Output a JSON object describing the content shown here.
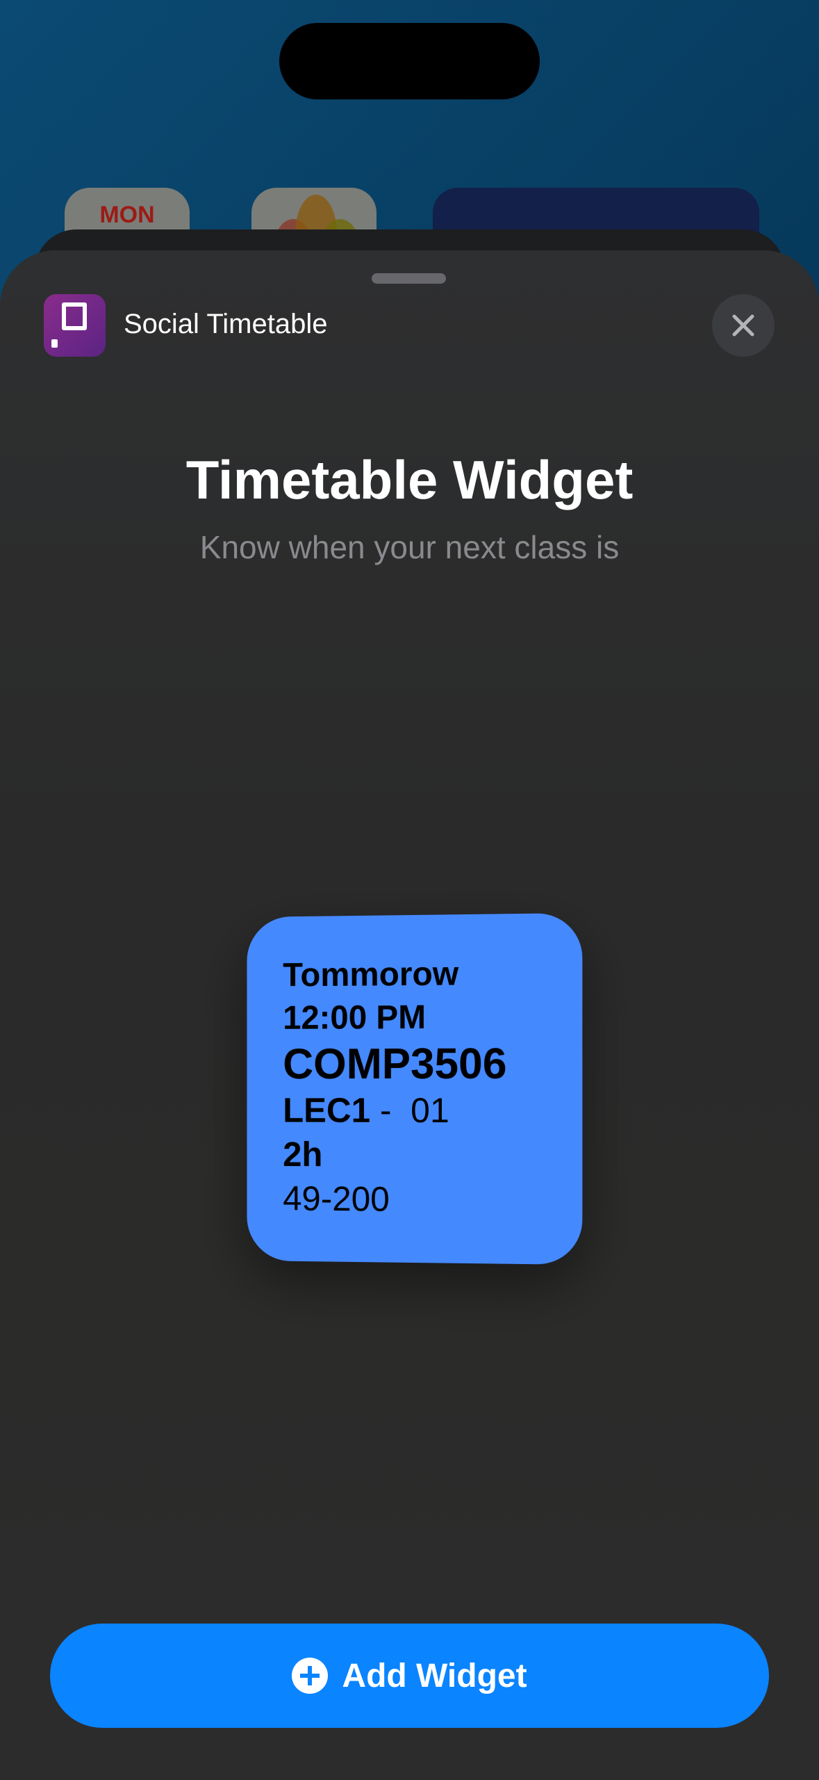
{
  "background_icons": {
    "calendar_day": "MON"
  },
  "header": {
    "app_name": "Social Timetable",
    "close_icon": "close-icon"
  },
  "main": {
    "title": "Timetable Widget",
    "subtitle": "Know when your next class is"
  },
  "widget": {
    "day": "Tommorow",
    "time": "12:00 PM",
    "course": "COMP3506",
    "activity": "LEC1",
    "separator": " -  ",
    "group": "01",
    "duration": "2h",
    "location": "49-200",
    "color": "#4589fe"
  },
  "add_button": {
    "label": "Add Widget",
    "color": "#0a84ff"
  }
}
